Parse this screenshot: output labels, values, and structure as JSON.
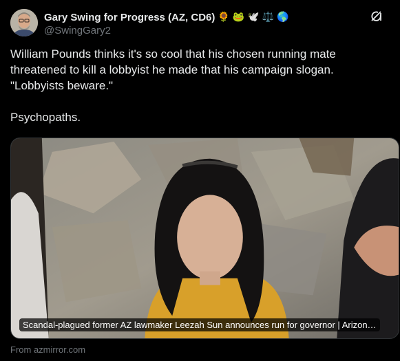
{
  "author": {
    "display_name": "Gary Swing for Progress (AZ, CD6)",
    "name_emojis": [
      "🌻",
      "🐸",
      "🕊️",
      "⚖️",
      "🌎"
    ],
    "handle": "@SwingGary2",
    "avatar_icon": "avatar-photo"
  },
  "toolbar": {
    "grok_icon": "grok-icon"
  },
  "tweet": {
    "text": "William Pounds thinks it's so cool that his chosen running mate threatened to kill a lobbyist he made that his campaign slogan. \"Lobbyists beware.\"\n\nPsychopaths."
  },
  "link_card": {
    "title": "Scandal-plagued former AZ lawmaker Leezah Sun announces run for governor | Arizon…",
    "source": "From azmirror.com"
  },
  "colors": {
    "background": "#000000",
    "text_primary": "#e7e9ea",
    "text_secondary": "#71767b"
  }
}
